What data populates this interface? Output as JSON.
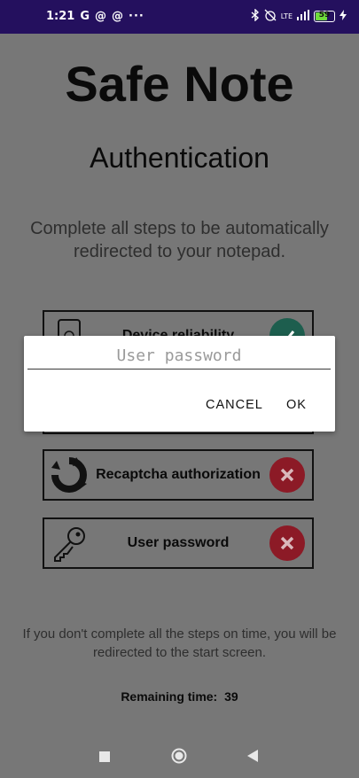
{
  "status_bar": {
    "time": "1:21",
    "icons": [
      "google-icon",
      "at-sign-icon",
      "at-sign-icon",
      "more-icon"
    ],
    "right_icons": [
      "bluetooth-icon",
      "alarm-off-icon",
      "network-icon",
      "signal-icon",
      "battery-icon",
      "charging-icon"
    ],
    "network_text": "LTE",
    "battery_level": "59",
    "battery_level_value": 59
  },
  "app": {
    "title": "Safe Note",
    "screen_title": "Authentication",
    "instructions": "Complete all steps to be automatically redirected to your notepad."
  },
  "steps": [
    {
      "label": "Device reliability",
      "status": "complete",
      "icon": "device-icon",
      "status_color": "#1d5e4e"
    },
    {
      "label": "",
      "status": "incomplete"
    },
    {
      "label": "Recaptcha authorization",
      "status": "incomplete",
      "icon": "recaptcha-icon",
      "status_color": "#8c1a26"
    },
    {
      "label": "User password",
      "status": "incomplete",
      "icon": "key-icon",
      "status_color": "#8c1a26"
    }
  ],
  "footer": {
    "warning": "If you don't complete all the steps on time, you will be redirected to the start screen.",
    "remaining_label": "Remaining time:",
    "remaining_value": "39"
  },
  "dialog": {
    "input_value": "",
    "input_placeholder": "User password",
    "cancel_label": "CANCEL",
    "ok_label": "OK"
  },
  "navbar": {
    "icons": [
      "recent-apps-icon",
      "home-icon",
      "back-icon"
    ]
  },
  "colors": {
    "status_bar_bg": "#24105e",
    "scrim_bg": "#777777",
    "complete": "#1d5e4e",
    "incomplete": "#8c1a26"
  }
}
